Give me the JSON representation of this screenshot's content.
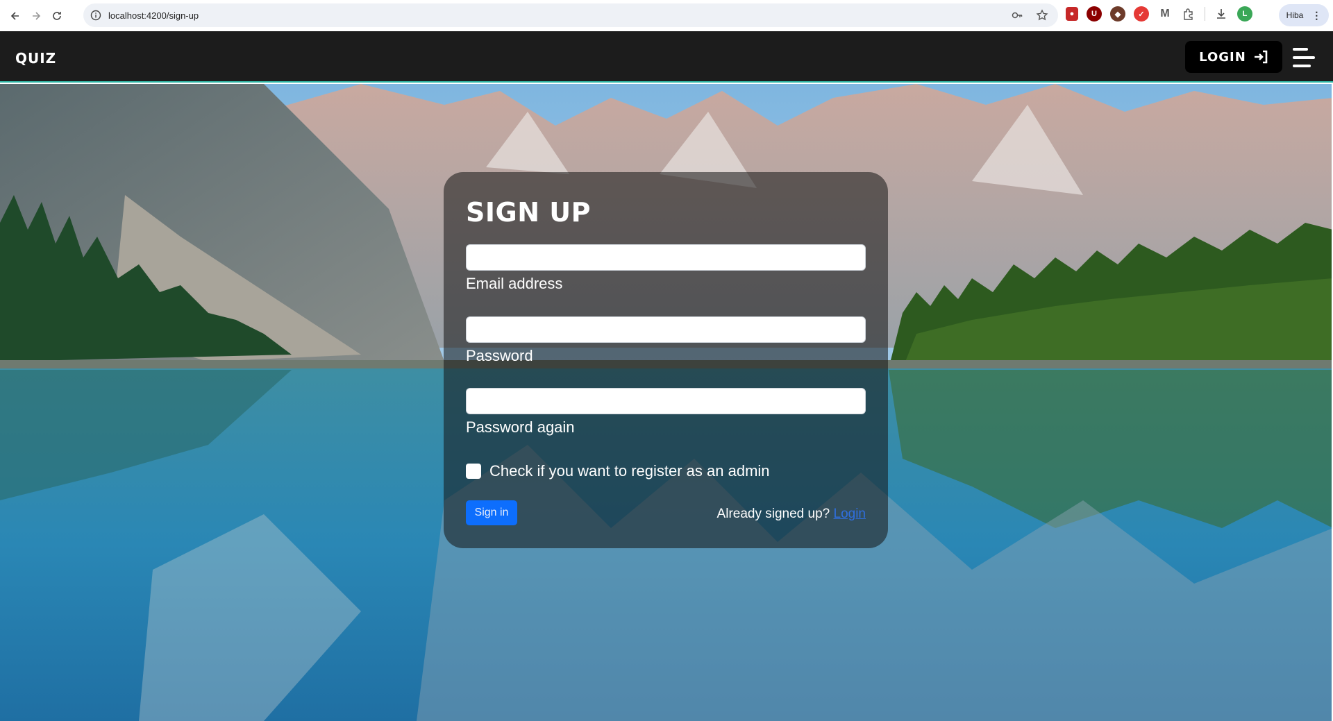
{
  "browser": {
    "url": "localhost:4200/sign-up",
    "profile_name": "Hiba"
  },
  "navbar": {
    "brand": "QUIZ",
    "login_label": "LOGIN"
  },
  "signup": {
    "title": "SIGN UP",
    "email_label": "Email address",
    "email_value": "",
    "password_label": "Password",
    "password_value": "",
    "password_again_label": "Password again",
    "password_again_value": "",
    "admin_checkbox_label": "Check if you want to register as an admin",
    "admin_checked": false,
    "submit_label": "Sign in",
    "already_text": "Already signed up?",
    "login_link": "Login"
  },
  "colors": {
    "navbar_bg": "#1c1c1c",
    "accent": "#2fb6a6",
    "primary_button": "#0d6efd",
    "link": "#2f6fe0"
  }
}
